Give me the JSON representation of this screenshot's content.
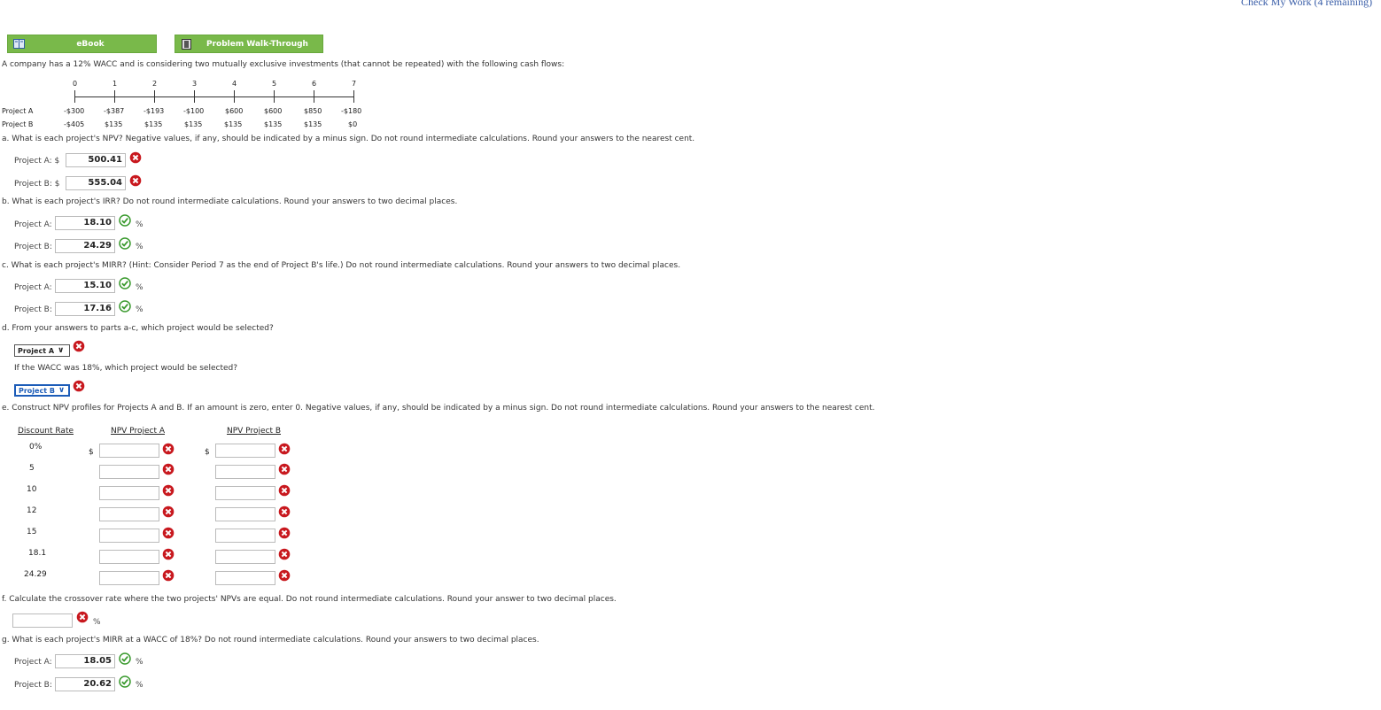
{
  "header": {
    "check_work": "Check My Work (4 remaining)"
  },
  "tabs": {
    "ebook": "eBook",
    "walkthrough": "Problem Walk-Through"
  },
  "problem": {
    "intro": "A company has a 12% WACC and is considering two mutually exclusive investments (that cannot be repeated) with the following cash flows:",
    "periods": [
      "0",
      "1",
      "2",
      "3",
      "4",
      "5",
      "6",
      "7"
    ],
    "project_a_label": "Project A",
    "project_b_label": "Project B",
    "project_a_flows": [
      "-$300",
      "-$387",
      "-$193",
      "-$100",
      "$600",
      "$600",
      "$850",
      "-$180"
    ],
    "project_b_flows": [
      "-$405",
      "$135",
      "$135",
      "$135",
      "$135",
      "$135",
      "$135",
      "$0"
    ]
  },
  "part_a": {
    "question": "a. What is each project's NPV? Negative values, if any, should be indicated by a minus sign. Do not round intermediate calculations. Round your answers to the nearest cent.",
    "a_label": "Project A: $",
    "a_value": "500.41",
    "b_label": "Project B: $",
    "b_value": "555.04"
  },
  "part_b": {
    "question": "b. What is each project's IRR? Do not round intermediate calculations. Round your answers to two decimal places.",
    "a_label": "Project A:",
    "a_value": "18.10",
    "b_label": "Project B:",
    "b_value": "24.29"
  },
  "part_c": {
    "question": "c. What is each project's MIRR? (Hint: Consider Period 7 as the end of Project B's life.) Do not round intermediate calculations. Round your answers to two decimal places.",
    "a_label": "Project A:",
    "a_value": "15.10",
    "b_label": "Project B:",
    "b_value": "17.16"
  },
  "part_d": {
    "question": "d. From your answers to parts a-c, which project would be selected?",
    "select1": "Project A",
    "question2": "If the WACC was 18%, which project would be selected?",
    "select2": "Project B"
  },
  "part_e": {
    "question": "e. Construct NPV profiles for Projects A and B. If an amount is zero, enter 0. Negative values, if any, should be indicated by a minus sign. Do not round intermediate calculations. Round your answers to the nearest cent.",
    "col_rate": "Discount Rate",
    "col_a": "NPV Project A",
    "col_b": "NPV Project B",
    "rates": [
      "0%",
      "5",
      "10",
      "12",
      "15",
      "18.1",
      "24.29"
    ],
    "dollar": "$"
  },
  "part_f": {
    "question": "f. Calculate the crossover rate where the two projects' NPVs are equal. Do not round intermediate calculations. Round your answer to two decimal places."
  },
  "part_g": {
    "question": "g. What is each project's MIRR at a WACC of 18%? Do not round intermediate calculations. Round your answers to two decimal places.",
    "a_label": "Project A:",
    "a_value": "18.05",
    "b_label": "Project B:",
    "b_value": "20.62"
  },
  "units": {
    "percent": "%"
  },
  "colors": {
    "tab_green": "#79b94a",
    "correct": "#3a9a2e",
    "wrong": "#c8181e",
    "focus_blue": "#1c5cb8"
  }
}
